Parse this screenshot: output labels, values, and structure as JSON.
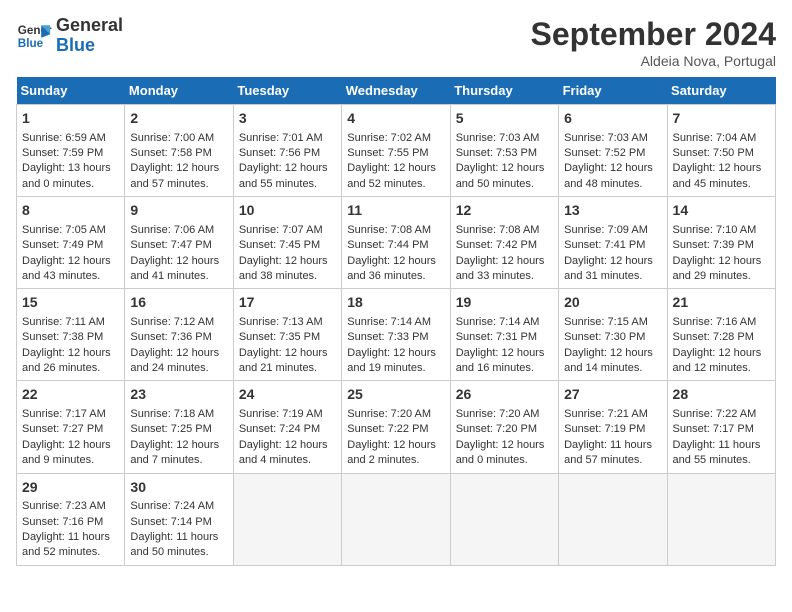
{
  "logo": {
    "line1": "General",
    "line2": "Blue"
  },
  "title": "September 2024",
  "location": "Aldeia Nova, Portugal",
  "days_of_week": [
    "Sunday",
    "Monday",
    "Tuesday",
    "Wednesday",
    "Thursday",
    "Friday",
    "Saturday"
  ],
  "weeks": [
    [
      {
        "day": 1,
        "sunrise": "6:59 AM",
        "sunset": "7:59 PM",
        "daylight": "13 hours and 0 minutes."
      },
      {
        "day": 2,
        "sunrise": "7:00 AM",
        "sunset": "7:58 PM",
        "daylight": "12 hours and 57 minutes."
      },
      {
        "day": 3,
        "sunrise": "7:01 AM",
        "sunset": "7:56 PM",
        "daylight": "12 hours and 55 minutes."
      },
      {
        "day": 4,
        "sunrise": "7:02 AM",
        "sunset": "7:55 PM",
        "daylight": "12 hours and 52 minutes."
      },
      {
        "day": 5,
        "sunrise": "7:03 AM",
        "sunset": "7:53 PM",
        "daylight": "12 hours and 50 minutes."
      },
      {
        "day": 6,
        "sunrise": "7:03 AM",
        "sunset": "7:52 PM",
        "daylight": "12 hours and 48 minutes."
      },
      {
        "day": 7,
        "sunrise": "7:04 AM",
        "sunset": "7:50 PM",
        "daylight": "12 hours and 45 minutes."
      }
    ],
    [
      {
        "day": 8,
        "sunrise": "7:05 AM",
        "sunset": "7:49 PM",
        "daylight": "12 hours and 43 minutes."
      },
      {
        "day": 9,
        "sunrise": "7:06 AM",
        "sunset": "7:47 PM",
        "daylight": "12 hours and 41 minutes."
      },
      {
        "day": 10,
        "sunrise": "7:07 AM",
        "sunset": "7:45 PM",
        "daylight": "12 hours and 38 minutes."
      },
      {
        "day": 11,
        "sunrise": "7:08 AM",
        "sunset": "7:44 PM",
        "daylight": "12 hours and 36 minutes."
      },
      {
        "day": 12,
        "sunrise": "7:08 AM",
        "sunset": "7:42 PM",
        "daylight": "12 hours and 33 minutes."
      },
      {
        "day": 13,
        "sunrise": "7:09 AM",
        "sunset": "7:41 PM",
        "daylight": "12 hours and 31 minutes."
      },
      {
        "day": 14,
        "sunrise": "7:10 AM",
        "sunset": "7:39 PM",
        "daylight": "12 hours and 29 minutes."
      }
    ],
    [
      {
        "day": 15,
        "sunrise": "7:11 AM",
        "sunset": "7:38 PM",
        "daylight": "12 hours and 26 minutes."
      },
      {
        "day": 16,
        "sunrise": "7:12 AM",
        "sunset": "7:36 PM",
        "daylight": "12 hours and 24 minutes."
      },
      {
        "day": 17,
        "sunrise": "7:13 AM",
        "sunset": "7:35 PM",
        "daylight": "12 hours and 21 minutes."
      },
      {
        "day": 18,
        "sunrise": "7:14 AM",
        "sunset": "7:33 PM",
        "daylight": "12 hours and 19 minutes."
      },
      {
        "day": 19,
        "sunrise": "7:14 AM",
        "sunset": "7:31 PM",
        "daylight": "12 hours and 16 minutes."
      },
      {
        "day": 20,
        "sunrise": "7:15 AM",
        "sunset": "7:30 PM",
        "daylight": "12 hours and 14 minutes."
      },
      {
        "day": 21,
        "sunrise": "7:16 AM",
        "sunset": "7:28 PM",
        "daylight": "12 hours and 12 minutes."
      }
    ],
    [
      {
        "day": 22,
        "sunrise": "7:17 AM",
        "sunset": "7:27 PM",
        "daylight": "12 hours and 9 minutes."
      },
      {
        "day": 23,
        "sunrise": "7:18 AM",
        "sunset": "7:25 PM",
        "daylight": "12 hours and 7 minutes."
      },
      {
        "day": 24,
        "sunrise": "7:19 AM",
        "sunset": "7:24 PM",
        "daylight": "12 hours and 4 minutes."
      },
      {
        "day": 25,
        "sunrise": "7:20 AM",
        "sunset": "7:22 PM",
        "daylight": "12 hours and 2 minutes."
      },
      {
        "day": 26,
        "sunrise": "7:20 AM",
        "sunset": "7:20 PM",
        "daylight": "12 hours and 0 minutes."
      },
      {
        "day": 27,
        "sunrise": "7:21 AM",
        "sunset": "7:19 PM",
        "daylight": "11 hours and 57 minutes."
      },
      {
        "day": 28,
        "sunrise": "7:22 AM",
        "sunset": "7:17 PM",
        "daylight": "11 hours and 55 minutes."
      }
    ],
    [
      {
        "day": 29,
        "sunrise": "7:23 AM",
        "sunset": "7:16 PM",
        "daylight": "11 hours and 52 minutes."
      },
      {
        "day": 30,
        "sunrise": "7:24 AM",
        "sunset": "7:14 PM",
        "daylight": "11 hours and 50 minutes."
      },
      null,
      null,
      null,
      null,
      null
    ]
  ]
}
